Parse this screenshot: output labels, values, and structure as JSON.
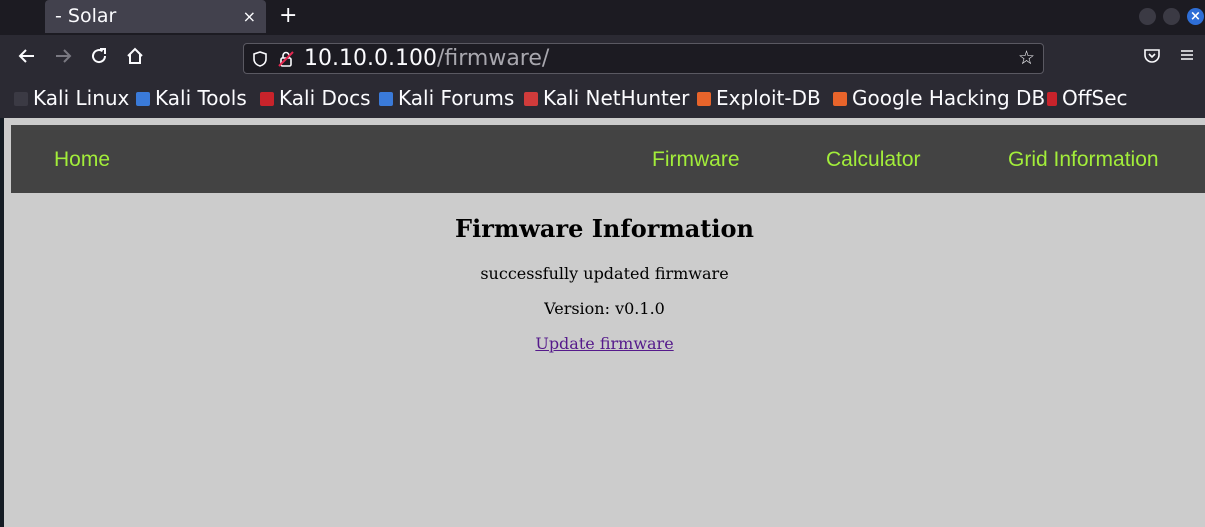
{
  "browser": {
    "tab_title": "- Solar",
    "tab_close": "×",
    "new_tab": "+",
    "url_host": "10.10.0.100",
    "url_path": "/firmware/",
    "bookmarks": [
      {
        "label": "Kali Linux",
        "icon": "kali-dragon-icon"
      },
      {
        "label": "Kali Tools",
        "icon": "kali-tools-icon"
      },
      {
        "label": "Kali Docs",
        "icon": "kali-docs-icon"
      },
      {
        "label": "Kali Forums",
        "icon": "kali-forums-icon"
      },
      {
        "label": "Kali NetHunter",
        "icon": "kali-nethunter-icon"
      },
      {
        "label": "Exploit-DB",
        "icon": "exploit-db-icon"
      },
      {
        "label": "Google Hacking DB",
        "icon": "ghdb-icon"
      },
      {
        "label": "OffSec",
        "icon": "offsec-icon"
      }
    ],
    "accent": "#2e6ed6"
  },
  "site": {
    "nav": {
      "home": "Home",
      "firmware": "Firmware",
      "calculator": "Calculator",
      "grid_information": "Grid Information"
    },
    "nav_link_color": "#a2ed3a",
    "nav_bg_color": "#434343",
    "page_bg_color": "#cccccc"
  },
  "main": {
    "title": "Firmware Information",
    "status_message": "successfully updated firmware",
    "version": "Version: v0.1.0",
    "update_link": "Update firmware"
  }
}
